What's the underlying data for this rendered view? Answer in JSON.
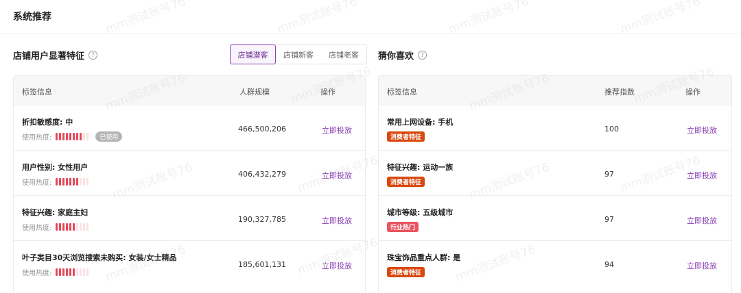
{
  "header": {
    "title": "系统推荐"
  },
  "left": {
    "title": "店铺用户显著特征",
    "tabs": [
      "店铺潜客",
      "店铺新客",
      "店铺老客"
    ],
    "columns": [
      "标签信息",
      "人群规模",
      "操作"
    ],
    "heat_label": "使用热度:",
    "used_label": "已使用",
    "rows": [
      {
        "name": "折扣敏感度: 中",
        "size": "466,500,206",
        "action": "立即投放",
        "heat_level": 8,
        "used": true
      },
      {
        "name": "用户性别: 女性用户",
        "size": "406,432,279",
        "action": "立即投放",
        "heat_level": 7,
        "used": false
      },
      {
        "name": "特征兴趣: 家庭主妇",
        "size": "190,327,785",
        "action": "立即投放",
        "heat_level": 6,
        "used": false
      },
      {
        "name": "叶子类目30天浏览搜索未购买: 女装/女士精品",
        "size": "185,601,131",
        "action": "立即投放",
        "heat_level": 6,
        "used": false
      }
    ]
  },
  "right": {
    "title": "猜你喜欢",
    "columns": [
      "标签信息",
      "推荐指数",
      "操作"
    ],
    "rows": [
      {
        "name": "常用上网设备: 手机",
        "tag": "消费者特征",
        "tag_color": "#d9480f",
        "score": "100",
        "action": "立即投放"
      },
      {
        "name": "特征兴趣: 运动一族",
        "tag": "消费者特征",
        "tag_color": "#d9480f",
        "score": "97",
        "action": "立即投放"
      },
      {
        "name": "城市等级: 五级城市",
        "tag": "行业热门",
        "tag_color": "#e8545f",
        "score": "97",
        "action": "立即投放"
      },
      {
        "name": "珠宝饰品重点人群: 是",
        "tag": "消费者特征",
        "tag_color": "#d9480f",
        "score": "94",
        "action": "立即投放"
      }
    ]
  },
  "watermark": "mm测试账号76"
}
